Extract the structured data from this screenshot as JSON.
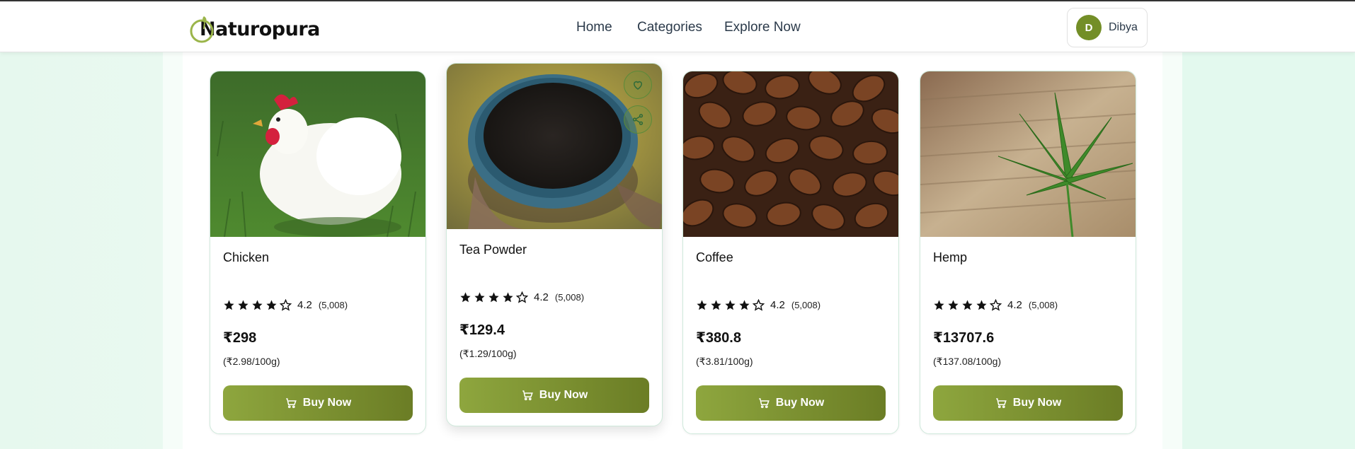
{
  "brand": {
    "name": "Naturopura"
  },
  "nav": [
    {
      "label": "Home"
    },
    {
      "label": "Categories"
    },
    {
      "label": "Explore Now"
    }
  ],
  "user": {
    "initial": "D",
    "name": "Dibya"
  },
  "colors": {
    "accent": "#738e27",
    "button_start": "#8ea63e",
    "button_end": "#6b7d25",
    "page_bg": "#eafaf1"
  },
  "products": [
    {
      "name": "Chicken",
      "rating": "4.2",
      "rating_stars": 4,
      "reviews": "(5,008)",
      "price": "₹298",
      "unit_price": "(₹2.98/100g)",
      "buy_label": "Buy Now",
      "image": "chicken"
    },
    {
      "name": "Tea Powder",
      "rating": "4.2",
      "rating_stars": 4,
      "reviews": "(5,008)",
      "price": "₹129.4",
      "unit_price": "(₹1.29/100g)",
      "buy_label": "Buy Now",
      "image": "tea-powder",
      "actions": [
        "heart-icon",
        "share-icon"
      ]
    },
    {
      "name": "Coffee",
      "rating": "4.2",
      "rating_stars": 4,
      "reviews": "(5,008)",
      "price": "₹380.8",
      "unit_price": "(₹3.81/100g)",
      "buy_label": "Buy Now",
      "image": "coffee-beans"
    },
    {
      "name": "Hemp",
      "rating": "4.2",
      "rating_stars": 4,
      "reviews": "(5,008)",
      "price": "₹13707.6",
      "unit_price": "(₹137.08/100g)",
      "buy_label": "Buy Now",
      "image": "hemp"
    }
  ]
}
